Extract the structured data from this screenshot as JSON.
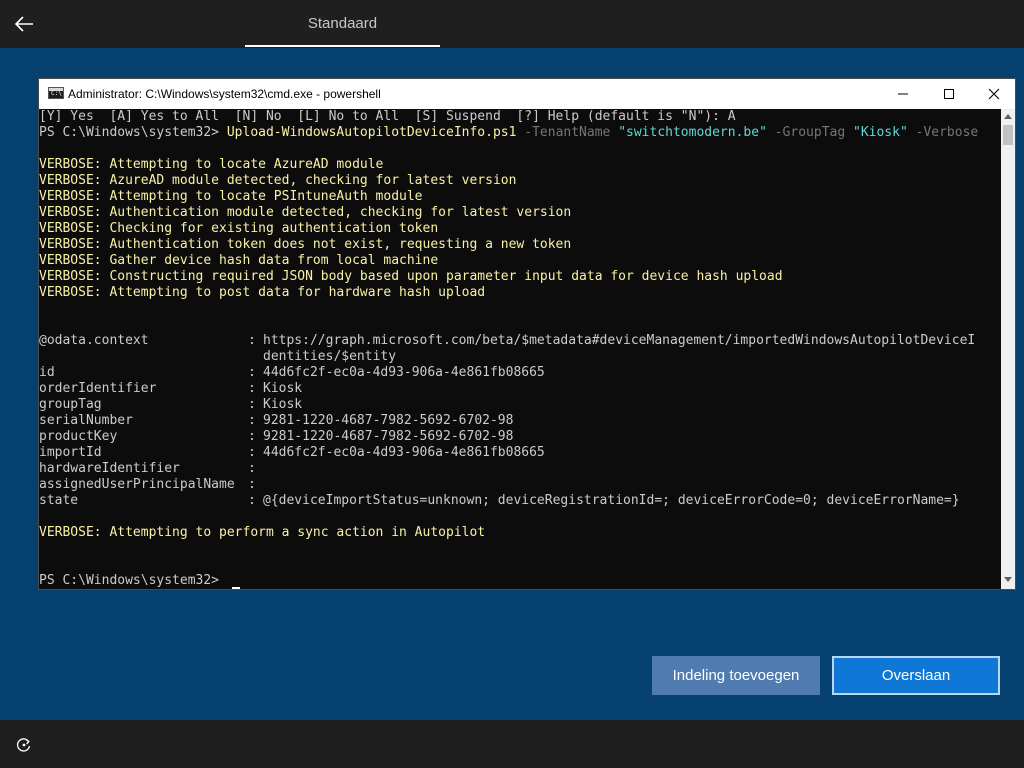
{
  "header": {
    "back_icon": "back-arrow-icon",
    "tab_label": "Standaard"
  },
  "window": {
    "title": "Administrator: C:\\Windows\\system32\\cmd.exe - powershell",
    "app_icon": "cmd-icon",
    "app_icon_glyph": "C:\\",
    "controls": [
      "minimize-icon",
      "maximize-icon",
      "close-icon"
    ]
  },
  "console": {
    "prompt_line": "[Y] Yes  [A] Yes to All  [N] No  [L] No to All  [S] Suspend  [?] Help (default is \"N\"): A",
    "command": {
      "prompt": "PS C:\\Windows\\system32> ",
      "cmdlet": "Upload-WindowsAutopilotDeviceInfo.ps1",
      "p1": " -TenantName ",
      "v1": "\"switchtomodern.be\"",
      "p2": " -GroupTag ",
      "v2": "\"Kiosk\"",
      "p3": " -Verbose"
    },
    "verbose_lines": [
      "VERBOSE: Attempting to locate AzureAD module",
      "VERBOSE: AzureAD module detected, checking for latest version",
      "VERBOSE: Attempting to locate PSIntuneAuth module",
      "VERBOSE: Authentication module detected, checking for latest version",
      "VERBOSE: Checking for existing authentication token",
      "VERBOSE: Authentication token does not exist, requesting a new token",
      "VERBOSE: Gather device hash data from local machine",
      "VERBOSE: Constructing required JSON body based upon parameter input data for device hash upload",
      "VERBOSE: Attempting to post data for hardware hash upload"
    ],
    "properties": [
      {
        "key": "@odata.context",
        "value": "https://graph.microsoft.com/beta/$metadata#deviceManagement/importedWindowsAutopilotDeviceI"
      },
      {
        "key": "",
        "value": "dentities/$entity"
      },
      {
        "key": "id",
        "value": "44d6fc2f-ec0a-4d93-906a-4e861fb08665"
      },
      {
        "key": "orderIdentifier",
        "value": "Kiosk"
      },
      {
        "key": "groupTag",
        "value": "Kiosk"
      },
      {
        "key": "serialNumber",
        "value": "9281-1220-4687-7982-5692-6702-98"
      },
      {
        "key": "productKey",
        "value": "9281-1220-4687-7982-5692-6702-98"
      },
      {
        "key": "importId",
        "value": "44d6fc2f-ec0a-4d93-906a-4e861fb08665"
      },
      {
        "key": "hardwareIdentifier",
        "value": ""
      },
      {
        "key": "assignedUserPrincipalName",
        "value": ""
      },
      {
        "key": "state",
        "value": "@{deviceImportStatus=unknown; deviceRegistrationId=; deviceErrorCode=0; deviceErrorName=}"
      }
    ],
    "sync_line": "VERBOSE: Attempting to perform a sync action in Autopilot",
    "final_prompt": "PS C:\\Windows\\system32> "
  },
  "buttons": {
    "secondary": "Indeling toevoegen",
    "primary": "Overslaan"
  },
  "footer": {
    "accessibility_icon": "ease-of-access-icon"
  }
}
